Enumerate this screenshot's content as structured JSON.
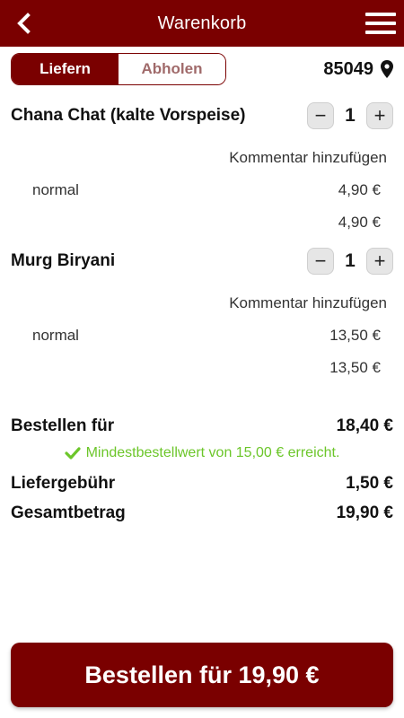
{
  "header": {
    "title": "Warenkorb",
    "back_icon": "chevron-left-icon",
    "menu_icon": "hamburger-menu-icon"
  },
  "delivery_toggle": {
    "options": [
      "Liefern",
      "Abholen"
    ],
    "selected": "Liefern"
  },
  "location": {
    "zip": "85049",
    "icon": "map-pin-icon"
  },
  "items": [
    {
      "name": "Chana Chat (kalte Vorspeise)",
      "quantity": "1",
      "comment_label": "Kommentar hinzufügen",
      "variant": "normal",
      "variant_price": "4,90 €",
      "subtotal": "4,90 €"
    },
    {
      "name": "Murg Biryani",
      "quantity": "1",
      "comment_label": "Kommentar hinzufügen",
      "variant": "normal",
      "variant_price": "13,50 €",
      "subtotal": "13,50 €"
    }
  ],
  "summary": {
    "order_for_label": "Bestellen für",
    "order_for_value": "18,40 €",
    "minimum_message": "Mindestbestellwert von 15,00 € erreicht.",
    "delivery_fee_label": "Liefergebühr",
    "delivery_fee_value": "1,50 €",
    "total_label": "Gesamtbetrag",
    "total_value": "19,90 €"
  },
  "order_button": {
    "label": "Bestellen für 19,90 €"
  },
  "colors": {
    "brand": "#7a0000",
    "success": "#6cc62a",
    "inactive_text": "#a06a6a"
  }
}
